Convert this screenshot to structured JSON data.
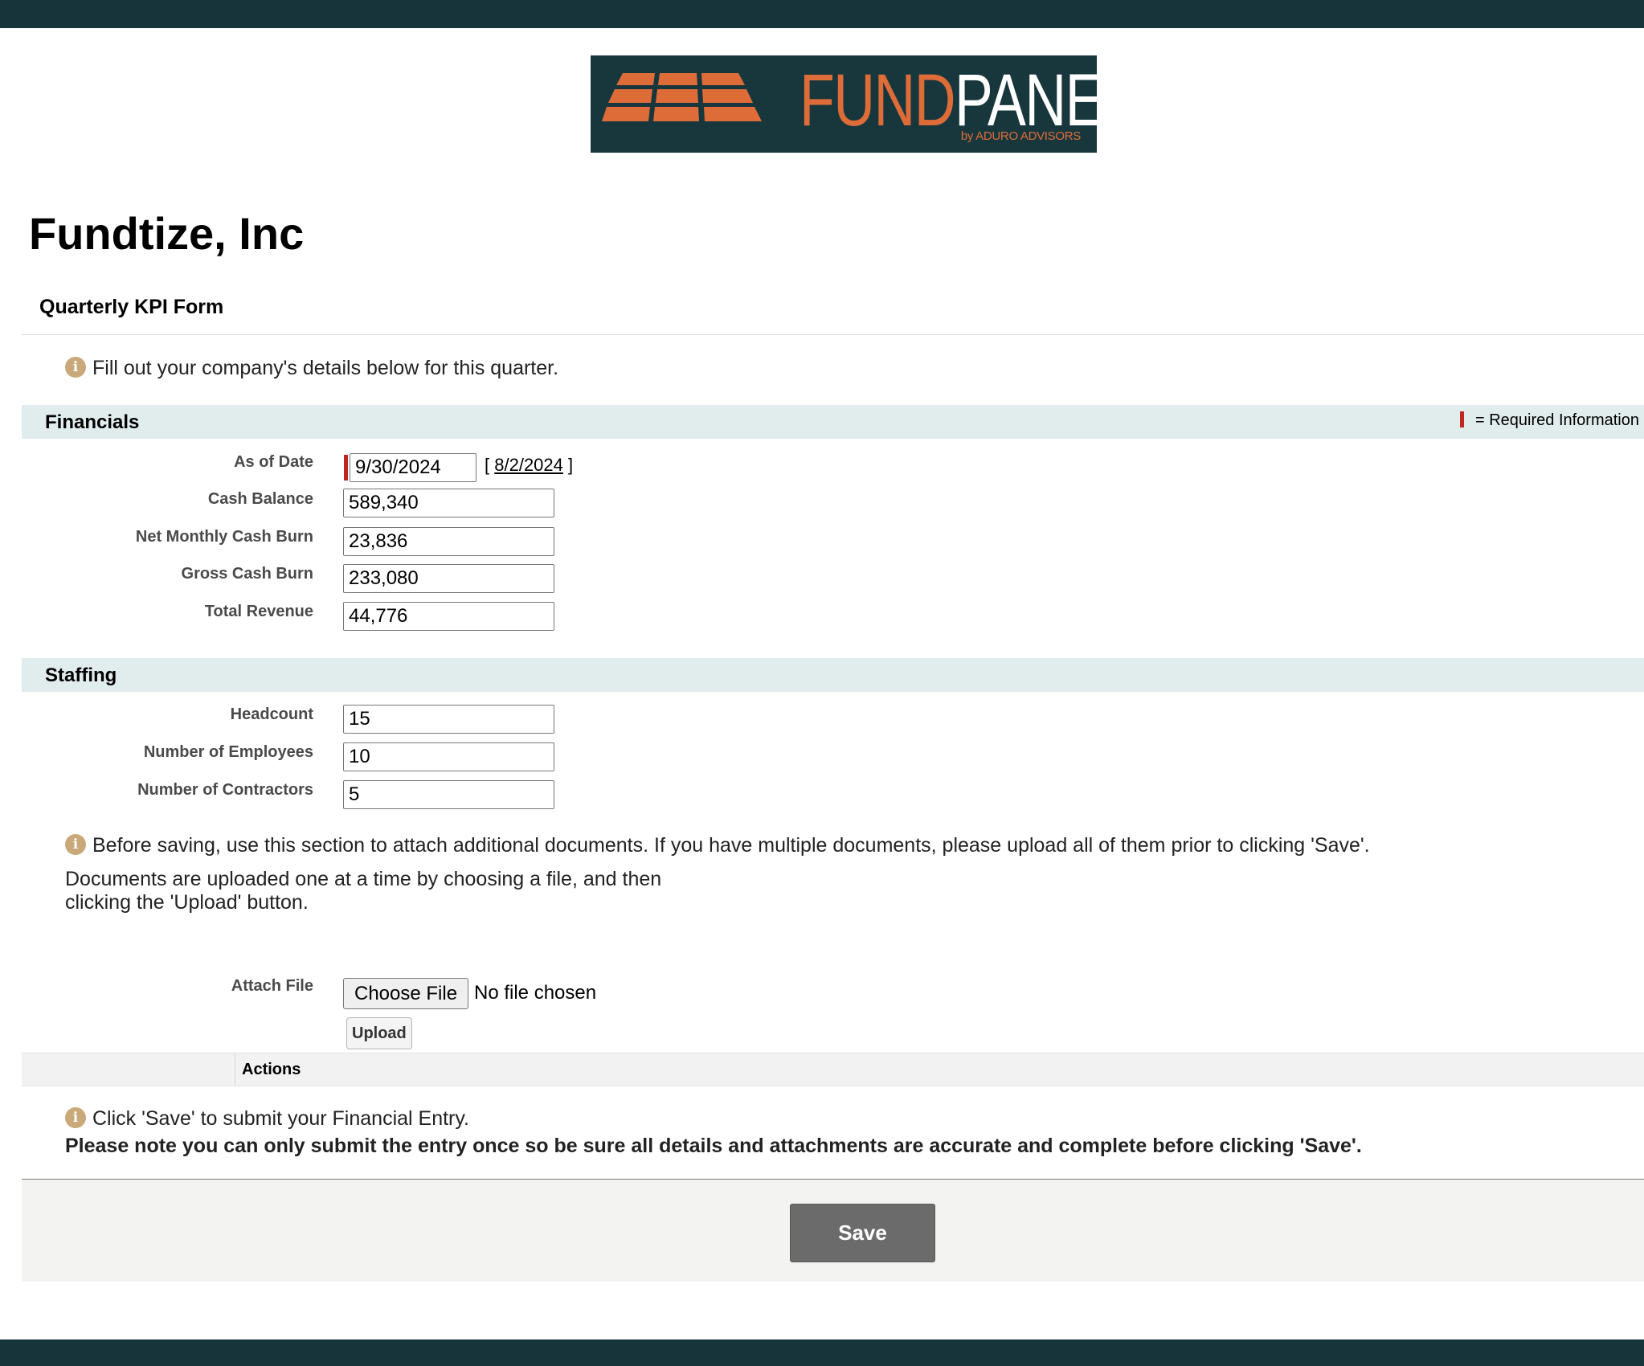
{
  "logo": {
    "fund": "FUND",
    "panel": "PANEL",
    "byline": "by ADURO ADVISORS",
    "colors": {
      "background": "#17373d",
      "accent": "#de6c38",
      "text": "#ffffff"
    }
  },
  "company_name": "Fundtize, Inc",
  "form_title": "Quarterly KPI Form",
  "intro_note": "Fill out your company's details below for this quarter.",
  "info_icon": "info-icon",
  "financials": {
    "title": "Financials",
    "required_legend": "= Required Information",
    "as_of_date": {
      "label": "As of Date",
      "value": "9/30/2024",
      "bracket_open": "[",
      "link": "8/2/2024",
      "bracket_close": "]"
    },
    "cash_balance": {
      "label": "Cash Balance",
      "value": "589,340"
    },
    "net_monthly_cash_burn": {
      "label": "Net Monthly Cash Burn",
      "value": "23,836"
    },
    "gross_cash_burn": {
      "label": "Gross Cash Burn",
      "value": "233,080"
    },
    "total_revenue": {
      "label": "Total Revenue",
      "value": "44,776"
    }
  },
  "staffing": {
    "title": "Staffing",
    "headcount": {
      "label": "Headcount",
      "value": "15"
    },
    "employees": {
      "label": "Number of Employees",
      "value": "10"
    },
    "contractors": {
      "label": "Number of Contractors",
      "value": "5"
    }
  },
  "documents": {
    "note": "Before saving, use this section to attach additional documents. If you have multiple documents, please upload all of them prior to clicking 'Save'.",
    "instructions": "Documents are uploaded one at a time by choosing a file, and then clicking the 'Upload' button.",
    "attach_label": "Attach File",
    "choose_button": "Choose File",
    "file_status": "No file chosen",
    "upload_button": "Upload"
  },
  "actions": {
    "title": "Actions",
    "save_note": "Click 'Save' to submit your Financial Entry.",
    "save_warning": "Please note you can only submit the entry once so be sure all details and attachments are accurate and complete before clicking 'Save'.",
    "save_button": "Save"
  },
  "colors": {
    "header_bar": "#17343b",
    "section_bar": "#e1eded",
    "required": "#c0281f",
    "info_icon": "#c9a979",
    "save_button": "#6b6b6b"
  }
}
